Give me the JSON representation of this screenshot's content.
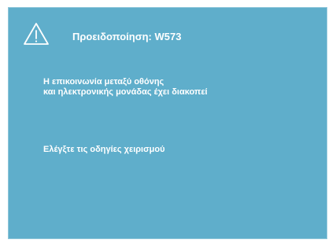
{
  "dialog": {
    "title": "Προειδοποίηση: W573",
    "message_line_1": "Η επικοινωνία μεταξύ οθόνης",
    "message_line_2": "και ηλεκτρονικής μονάδας έχει διακοπεί",
    "instruction": "Ελέγξτε τις οδηγίες χειρισμού",
    "icon": "warning-triangle-icon",
    "background_color": "#5faecb",
    "text_color": "#ffffff"
  }
}
